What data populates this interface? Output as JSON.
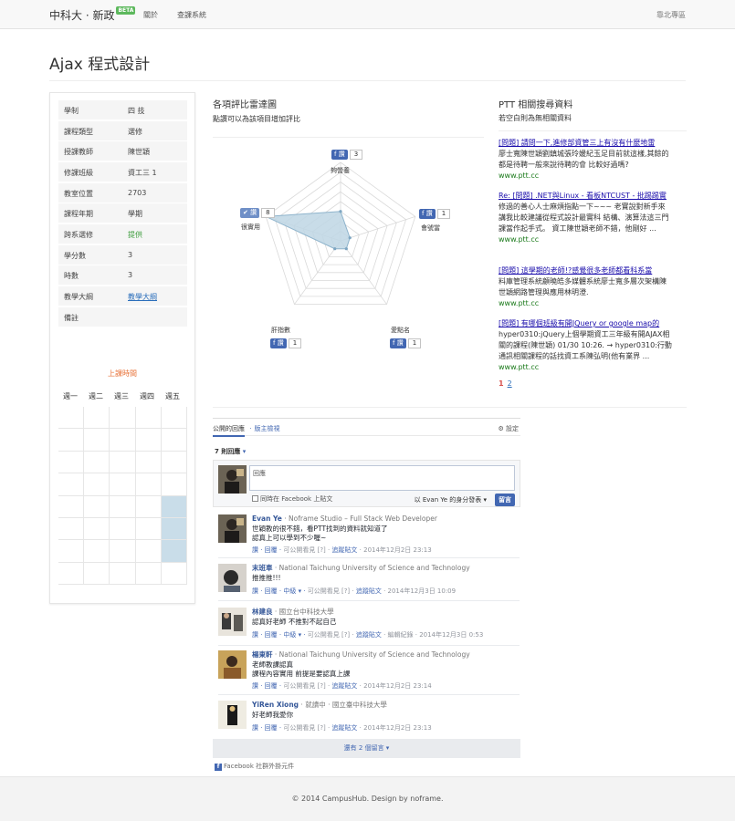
{
  "navbar": {
    "brand": "中科大 · 新政",
    "beta": "BETA",
    "links": [
      "關於",
      "查課系統"
    ],
    "right": "靠北專區"
  },
  "page_title": "Ajax 程式設計",
  "course_info": [
    {
      "label": "學制",
      "value": "四 技"
    },
    {
      "label": "課程類型",
      "value": "選修"
    },
    {
      "label": "授課教師",
      "value": "陳世穎"
    },
    {
      "label": "修課班級",
      "value": "資工三 1"
    },
    {
      "label": "教室位置",
      "value": "2703"
    },
    {
      "label": "課程年期",
      "value": "學期"
    },
    {
      "label": "跨系選修",
      "value": "提供"
    },
    {
      "label": "學分數",
      "value": "3"
    },
    {
      "label": "時數",
      "value": "3"
    },
    {
      "label": "教學大綱",
      "value": "教學大綱"
    },
    {
      "label": "備註",
      "value": ""
    }
  ],
  "schedule": {
    "title": "上課時間",
    "days": [
      "週一",
      "週二",
      "週三",
      "週四",
      "週五"
    ],
    "highlighted": [
      {
        "day": 5,
        "periods": [
          5,
          6,
          7
        ]
      }
    ]
  },
  "radar": {
    "title": "各項評比雷達圖",
    "subtitle": "點讚可以為該項目增加評比",
    "like_label": "讚",
    "axes": [
      {
        "name": "夠營養",
        "count": 3,
        "liked": false
      },
      {
        "name": "會號當",
        "count": 1,
        "liked": false
      },
      {
        "name": "愛點名",
        "count": 1,
        "liked": false
      },
      {
        "name": "肝指數",
        "count": 1,
        "liked": false
      },
      {
        "name": "很實用",
        "count": 8,
        "liked": true
      }
    ],
    "max": 8
  },
  "ptt": {
    "title": "PTT 相關搜尋資料",
    "subtitle": "若空白則為無相關資料",
    "results": [
      {
        "title": "[問題] 請問一下,進修部資管三上有沒有什麼地雷",
        "snippet": "廖士寬陳世穎劉鎮城張玲媛紀玉足目前就這樣,其餘的都是待聘一般來說待聘的會 比較好過嗎?",
        "url": "www.ptt.cc"
      },
      {
        "title": "Re: [問題] .NET與Linux - 看板NTCUST - 批踢踢實",
        "snippet": "修過的善心人士麻煩指點一下~~~ 老實說對新手來講我比較建議從程式設計最實科 結構、演算法這三門課當作起手式。 資工陳世穎老師不錯，他剛好 ...",
        "url": "www.ptt.cc"
      },
      {
        "title": "[問題] 這學期的老師!?感覺很多老師都看科系當",
        "snippet": "料庫管理系統顧曉皓多媒體系統廖士寬多層次架構陳世穎網路管理與應用林明澄.",
        "url": "www.ptt.cc"
      },
      {
        "title": "[問題] 有哪個班級有開JQuery or google map的",
        "snippet": "hyper0310:jQuery上個學期資工三年級有開AJAX相關的課程(陳世穎) 01/30 10:26. → hyper0310:行動通訊相關課程的話找資工系陳弘明(他有業界 ...",
        "url": "www.ptt.cc"
      }
    ],
    "pages": [
      "1",
      "2"
    ]
  },
  "comments": {
    "tab_public": "公開的回應",
    "tab_moderator": "版主檢視",
    "settings": "設定",
    "count": "7 則回應",
    "compose_placeholder": "回應",
    "post_to_fb": "同時在 Facebook 上貼文",
    "post_as": "以 Evan Ye 的身分發表",
    "post_button": "留言",
    "items": [
      {
        "name": "Evan Ye",
        "aff": "· Noframe Studio – Full Stack Web Developer",
        "body": "世穎教的很不錯，看PTT找到的資料就知道了\n認真上可以學到不少喔~",
        "meta_links": "讚 · 回覆 · ",
        "meta_gray": "可公開看見 [?] · ",
        "follow": "追蹤貼文",
        "time": " · 2014年12月2日 23:13"
      },
      {
        "name": "末班車",
        "aff": "· National Taichung University of Science and Technology",
        "body": "推推推!!!",
        "meta_links": "讚 · 回覆 · 中級 ▾ · ",
        "meta_gray": "可公開看見 [?] · ",
        "follow": "追蹤貼文",
        "time": " · 2014年12月3日 10:09"
      },
      {
        "name": "林建良",
        "aff": "· 國立台中科技大學",
        "body": "認真好老師 不推對不起自己",
        "meta_links": "讚 · 回覆 · 中級 ▾ · ",
        "meta_gray": "可公開看見 [?] · ",
        "follow": "追蹤貼文",
        "time": " · 編輯紀錄 · 2014年12月3日 0:53"
      },
      {
        "name": "楊東軒",
        "aff": "· National Taichung University of Science and Technology",
        "body": "老師教課認真\n課程內容實用 前提是要認真上課",
        "meta_links": "讚 · 回覆 · ",
        "meta_gray": "可公開看見 [?] · ",
        "follow": "追蹤貼文",
        "time": " · 2014年12月2日 23:14"
      },
      {
        "name": "YiRen Xiong",
        "aff": "· 就讀中 · 國立臺中科技大學",
        "body": "好老師我愛你",
        "meta_links": "讚 · 回覆 · ",
        "meta_gray": "可公開看見 [?] · ",
        "follow": "追蹤貼文",
        "time": " · 2014年12月2日 23:13"
      }
    ],
    "more": "還有 2 個留言 ▾",
    "plugin": "Facebook 社群外掛元件"
  },
  "footer": "© 2014 CampusHub. Design by noframe."
}
